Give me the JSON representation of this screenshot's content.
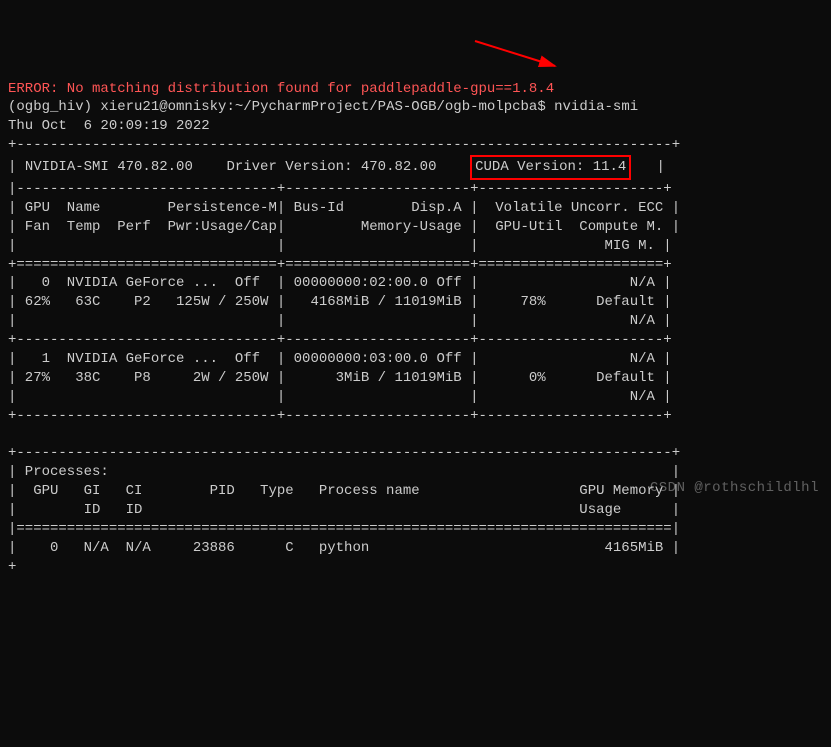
{
  "top_error": "ERROR: No matching distribution found for paddlepaddle-gpu==1.8.4",
  "prompt": {
    "env": "(ogbg_hiv)",
    "userhost": "xieru21@omnisky",
    "path": "~/PycharmProject/PAS-OGB/ogb-molpcba",
    "symbol": "$",
    "command": "nvidia-smi"
  },
  "timestamp": "Thu Oct  6 20:09:19 2022",
  "header": {
    "smi_version": "NVIDIA-SMI 470.82.00",
    "driver_version": "Driver Version: 470.82.00",
    "cuda_version": "CUDA Version: 11.4"
  },
  "columns": {
    "row1": "| GPU  Name        Persistence-M| Bus-Id        Disp.A |  Volatile Uncorr. ECC |",
    "row2": "| Fan  Temp  Perf  Pwr:Usage/Cap|         Memory-Usage |  GPU-Util  Compute M. |",
    "row3": "|                               |                      |               MIG M. |"
  },
  "gpu0": {
    "r1": "|   0  NVIDIA GeForce ...  Off  | 00000000:02:00.0 Off |                  N/A |",
    "r2": "| 62%   63C    P2   125W / 250W |   4168MiB / 11019MiB |     78%      Default |",
    "r3": "|                               |                      |                  N/A |"
  },
  "gpu1": {
    "r1": "|   1  NVIDIA GeForce ...  Off  | 00000000:03:00.0 Off |                  N/A |",
    "r2": "| 27%   38C    P8     2W / 250W |      3MiB / 11019MiB |      0%      Default |",
    "r3": "|                               |                      |                  N/A |"
  },
  "processes": {
    "title": "| Processes:                                                                   |",
    "h1": "|  GPU   GI   CI        PID   Type   Process name                   GPU Memory |",
    "h2": "|        ID   ID                                                    Usage      |",
    "p1": "|    0   N/A  N/A     23886      C   python                            4165MiB |"
  },
  "borders": {
    "top": "+-------------------------------+----------------------+----------------------+",
    "mid": "+===============================+======================+======================+",
    "plain": "+-------------------------------+----------------------+----------------------+",
    "full": "+------------------------------------------------------------------------------+",
    "fulleq": "|==============================================================================|",
    "header_top": "+------------------------------------------------------------------------------+",
    "header_row": "|-------------------------------+----------------------+----------------------+"
  },
  "watermark": "CSDN @rothschildlhl"
}
